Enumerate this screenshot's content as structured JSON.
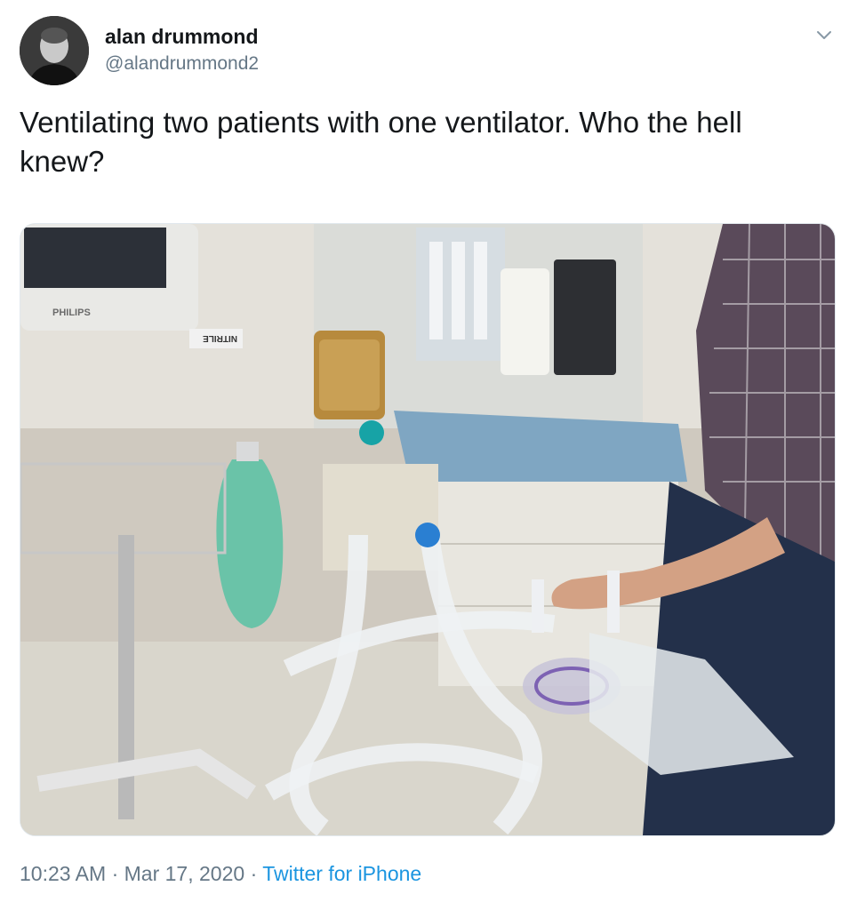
{
  "author": {
    "name": "alan drummond",
    "handle": "@alandrummond2",
    "avatar_icon": "user-avatar-photo"
  },
  "tweet": {
    "text": "Ventilating two patients with one ventilator. Who the hell knew?",
    "photo_label": "PHILIPS",
    "photo_glove_label": "NITRILE"
  },
  "meta": {
    "time": "10:23 AM",
    "separator": "·",
    "date": "Mar 17, 2020",
    "source": "Twitter for iPhone"
  },
  "colors": {
    "text": "#14171a",
    "secondary": "#657786",
    "link": "#1b95e0"
  },
  "icons": {
    "menu": "chevron-down-icon"
  }
}
